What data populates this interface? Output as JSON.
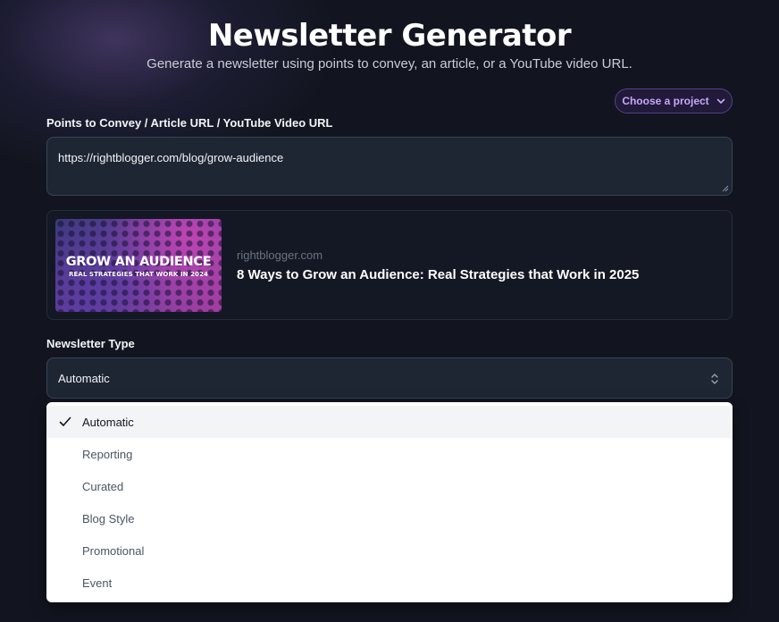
{
  "header": {
    "title": "Newsletter Generator",
    "subtitle": "Generate a newsletter using points to convey, an article, or a YouTube video URL."
  },
  "project_button": {
    "label": "Choose a project",
    "icon": "chevron-down-icon"
  },
  "url_field": {
    "label": "Points to Convey / Article URL / YouTube Video URL",
    "value": "https://rightblogger.com/blog/grow-audience"
  },
  "preview": {
    "thumbnail_title": "GROW AN AUDIENCE",
    "thumbnail_subtitle": "REAL STRATEGIES THAT WORK IN 2024",
    "domain": "rightblogger.com",
    "title": "8 Ways to Grow an Audience: Real Strategies that Work in 2025"
  },
  "newsletter_type": {
    "label": "Newsletter Type",
    "selected": "Automatic",
    "options": [
      "Automatic",
      "Reporting",
      "Curated",
      "Blog Style",
      "Promotional",
      "Event"
    ]
  },
  "colors": {
    "background": "#12151f",
    "accent": "#c7a6ff",
    "input_bg": "#1e2533"
  }
}
